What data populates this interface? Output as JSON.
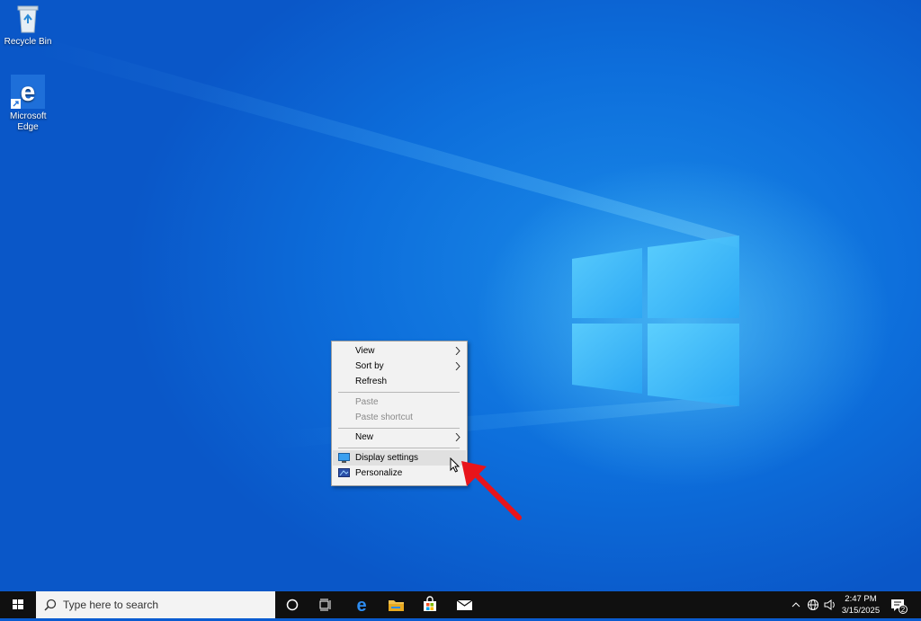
{
  "desktop_icons": [
    {
      "label": "Recycle Bin",
      "icon": "recycle-bin-icon"
    },
    {
      "label": "Microsoft Edge",
      "icon": "edge-icon"
    }
  ],
  "context_menu": {
    "items": [
      {
        "label": "View",
        "submenu": true,
        "enabled": true
      },
      {
        "label": "Sort by",
        "submenu": true,
        "enabled": true
      },
      {
        "label": "Refresh",
        "submenu": false,
        "enabled": true
      },
      {
        "label": "Paste",
        "submenu": false,
        "enabled": false
      },
      {
        "label": "Paste shortcut",
        "submenu": false,
        "enabled": false
      },
      {
        "label": "New",
        "submenu": true,
        "enabled": true
      },
      {
        "label": "Display settings",
        "submenu": false,
        "enabled": true,
        "icon": "display-icon",
        "highlighted": true
      },
      {
        "label": "Personalize",
        "submenu": false,
        "enabled": true,
        "icon": "personalize-icon"
      }
    ]
  },
  "taskbar": {
    "search_placeholder": "Type here to search",
    "pinned": [
      "cortana-icon",
      "task-view-icon",
      "edge-icon",
      "file-explorer-icon",
      "store-icon",
      "mail-icon"
    ],
    "tray": {
      "time": "2:47 PM",
      "date": "3/15/2025",
      "notification_count": "2"
    }
  },
  "colors": {
    "accent_arrow": "#e8141b",
    "desktop_blue": "#0a5cd0",
    "taskbar": "#101010"
  }
}
